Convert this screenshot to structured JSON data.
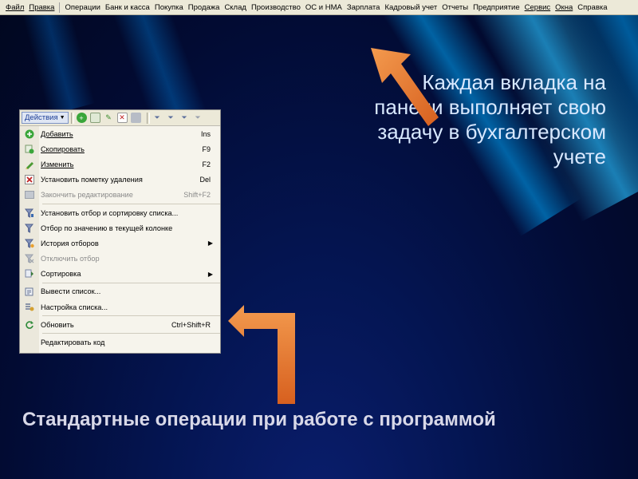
{
  "menubar": {
    "items": [
      "Файл",
      "Правка",
      "Операции",
      "Банк и касса",
      "Покупка",
      "Продажа",
      "Склад",
      "Производство",
      "ОС и НМА",
      "Зарплата",
      "Кадровый учет",
      "Отчеты",
      "Предприятие",
      "Сервис",
      "Окна",
      "Справка"
    ]
  },
  "toolbar": {
    "actions_label": "Действия"
  },
  "menu": [
    {
      "label": "Добавить",
      "shortcut": "Ins",
      "icon": "add-icon",
      "enabled": true
    },
    {
      "label": "Скопировать",
      "shortcut": "F9",
      "icon": "copy-icon",
      "enabled": true
    },
    {
      "label": "Изменить",
      "shortcut": "F2",
      "icon": "pencil-icon",
      "enabled": true
    },
    {
      "label": "Установить пометку удаления",
      "shortcut": "Del",
      "icon": "delete-mark-icon",
      "enabled": true
    },
    {
      "label": "Закончить редактирование",
      "shortcut": "Shift+F2",
      "icon": "finish-edit-icon",
      "enabled": false
    },
    {
      "label": "Установить отбор и сортировку списка...",
      "shortcut": "",
      "icon": "filter-sort-icon",
      "enabled": true
    },
    {
      "label": "Отбор по значению в текущей колонке",
      "shortcut": "",
      "icon": "filter-value-icon",
      "enabled": true
    },
    {
      "label": "История отборов",
      "shortcut": "",
      "icon": "filter-history-icon",
      "enabled": true,
      "submenu": true
    },
    {
      "label": "Отключить отбор",
      "shortcut": "",
      "icon": "filter-off-icon",
      "enabled": false
    },
    {
      "label": "Сортировка",
      "shortcut": "",
      "icon": "sort-icon",
      "enabled": true,
      "submenu": true
    },
    {
      "label": "Вывести список...",
      "shortcut": "",
      "icon": "print-list-icon",
      "enabled": true
    },
    {
      "label": "Настройка списка...",
      "shortcut": "",
      "icon": "list-settings-icon",
      "enabled": true
    },
    {
      "label": "Обновить",
      "shortcut": "Ctrl+Shift+R",
      "icon": "refresh-icon",
      "enabled": true
    },
    {
      "label": "Редактировать код",
      "shortcut": "",
      "icon": "",
      "enabled": true
    }
  ],
  "slide": {
    "callout": "Каждая вкладка на панели выполняет свою задачу в бухгалтерском учете",
    "caption": "Стандартные операции при работе с программой"
  },
  "colors": {
    "arrow": "#e8742a",
    "callout_text": "#d8e8ff",
    "background": "#03164a"
  }
}
